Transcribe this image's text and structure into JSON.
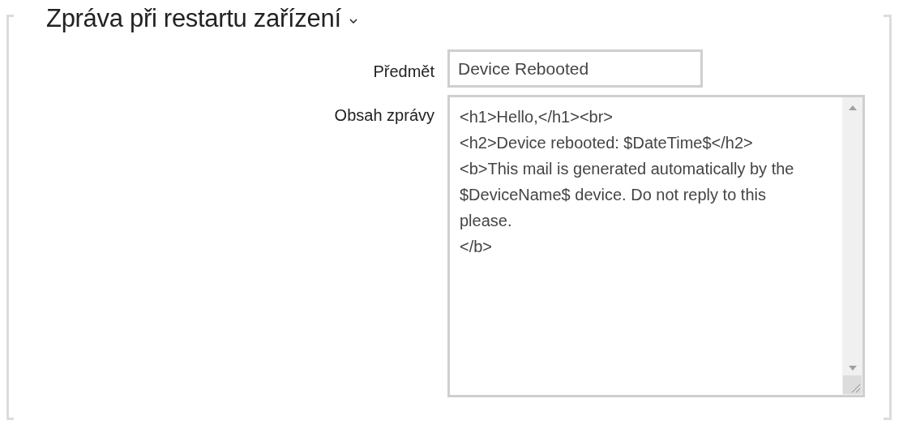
{
  "section": {
    "title": "Zpráva při restartu zařízení",
    "expanded": true
  },
  "fields": [
    {
      "kind": "input",
      "label": "Předmět",
      "value": "Device Rebooted"
    },
    {
      "kind": "textarea",
      "label": "Obsah zprávy",
      "value": "<h1>Hello,</h1><br>\n<h2>Device rebooted: $DateTime$</h2>\n<b>This mail is generated automatically by the $DeviceName$ device. Do not reply to this please.\n</b>"
    }
  ]
}
